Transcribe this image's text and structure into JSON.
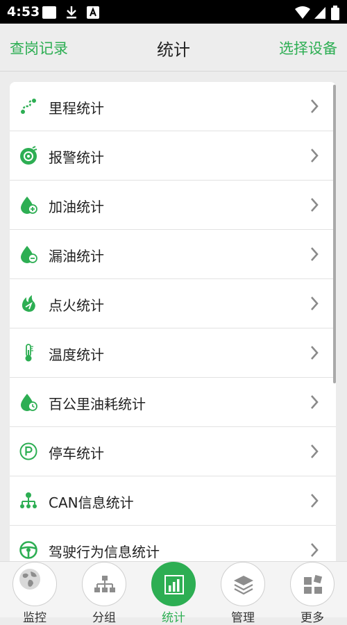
{
  "status_bar": {
    "time": "4:53"
  },
  "header": {
    "left_label": "查岗记录",
    "title": "统计",
    "right_label": "选择设备"
  },
  "list": [
    {
      "label": "里程统计",
      "icon": "mileage-icon"
    },
    {
      "label": "报警统计",
      "icon": "alarm-icon"
    },
    {
      "label": "加油统计",
      "icon": "refuel-icon"
    },
    {
      "label": "漏油统计",
      "icon": "oil-leak-icon"
    },
    {
      "label": "点火统计",
      "icon": "ignition-icon"
    },
    {
      "label": "温度统计",
      "icon": "thermometer-icon"
    },
    {
      "label": "百公里油耗统计",
      "icon": "fuel-consumption-icon"
    },
    {
      "label": "停车统计",
      "icon": "parking-icon"
    },
    {
      "label": "CAN信息统计",
      "icon": "can-network-icon"
    },
    {
      "label": "驾驶行为信息统计",
      "icon": "steering-wheel-icon"
    }
  ],
  "tabs": [
    {
      "label": "监控",
      "icon": "globe-icon",
      "active": false
    },
    {
      "label": "分组",
      "icon": "hierarchy-icon",
      "active": false
    },
    {
      "label": "统计",
      "icon": "bar-chart-icon",
      "active": true
    },
    {
      "label": "管理",
      "icon": "layers-icon",
      "active": false
    },
    {
      "label": "更多",
      "icon": "more-grid-icon",
      "active": false
    }
  ],
  "colors": {
    "accent": "#2dae53",
    "header_bg": "#ededed",
    "status_bar_bg": "#000000"
  }
}
